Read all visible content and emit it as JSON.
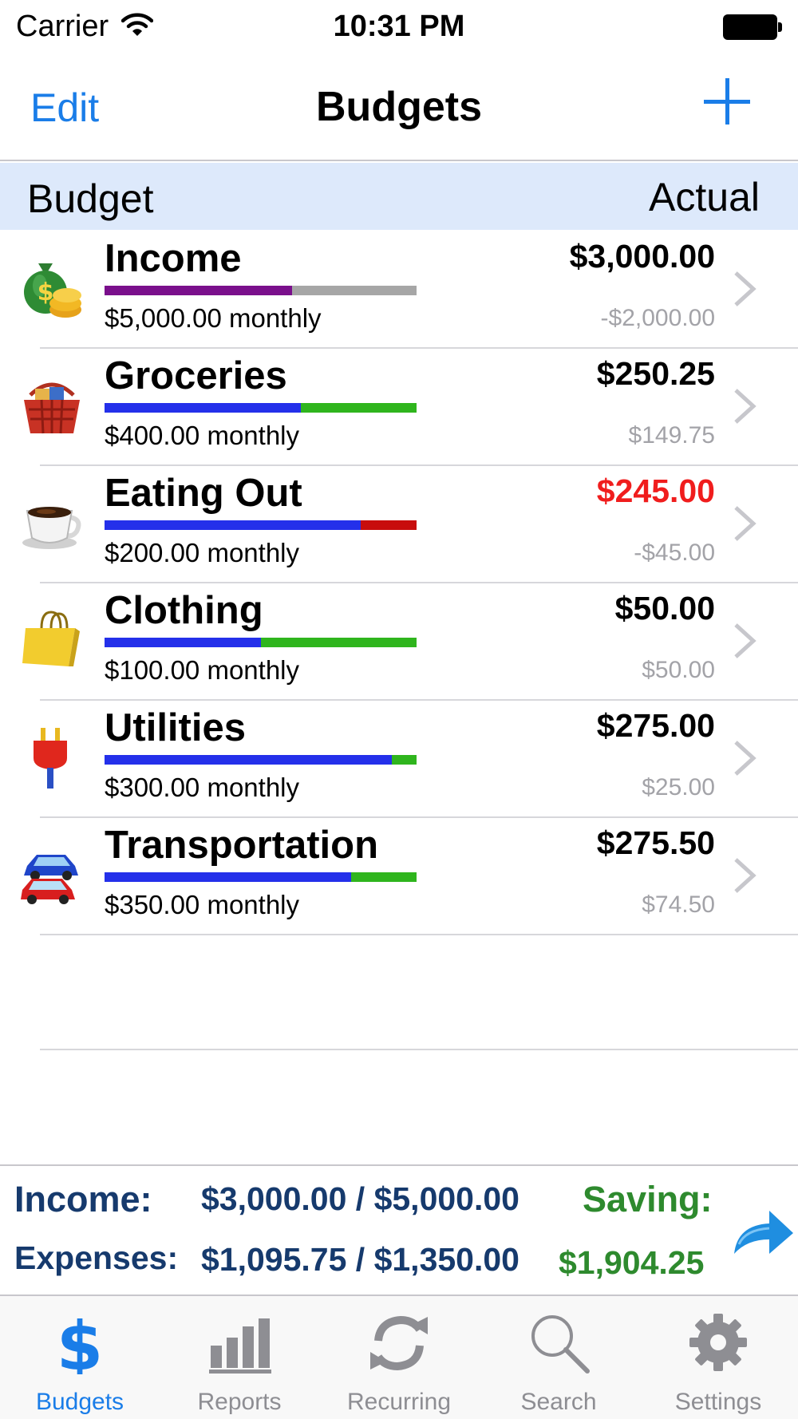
{
  "status_bar": {
    "carrier": "Carrier",
    "time": "10:31 PM"
  },
  "nav": {
    "edit_label": "Edit",
    "title": "Budgets"
  },
  "section_header": {
    "left": "Budget",
    "right": "Actual"
  },
  "rows": [
    {
      "name": "Income",
      "budget": "$5,000.00 monthly",
      "actual": "$3,000.00",
      "diff": "-$2,000.00",
      "icon": "money-bag-icon",
      "progress": 0.6,
      "fill_color": "#7a0f8c",
      "rest_color": "#a6a6a6",
      "actual_color": "#000000"
    },
    {
      "name": "Groceries",
      "budget": "$400.00 monthly",
      "actual": "$250.25",
      "diff": "$149.75",
      "icon": "grocery-basket-icon",
      "progress": 0.63,
      "fill_color": "#2430ea",
      "rest_color": "#2fb51d",
      "actual_color": "#000000"
    },
    {
      "name": "Eating Out",
      "budget": "$200.00 monthly",
      "actual": "$245.00",
      "diff": "-$45.00",
      "icon": "coffee-cup-icon",
      "progress": 0.82,
      "fill_color": "#2430ea",
      "rest_color": "#c80d0d",
      "actual_color": "#f01d1d"
    },
    {
      "name": "Clothing",
      "budget": "$100.00 monthly",
      "actual": "$50.00",
      "diff": "$50.00",
      "icon": "shopping-bag-icon",
      "progress": 0.5,
      "fill_color": "#2430ea",
      "rest_color": "#2fb51d",
      "actual_color": "#000000"
    },
    {
      "name": "Utilities",
      "budget": "$300.00 monthly",
      "actual": "$275.00",
      "diff": "$25.00",
      "icon": "power-plug-icon",
      "progress": 0.92,
      "fill_color": "#2430ea",
      "rest_color": "#2fb51d",
      "actual_color": "#000000"
    },
    {
      "name": "Transportation",
      "budget": "$350.00 monthly",
      "actual": "$275.50",
      "diff": "$74.50",
      "icon": "cars-icon",
      "progress": 0.79,
      "fill_color": "#2430ea",
      "rest_color": "#2fb51d",
      "actual_color": "#000000"
    }
  ],
  "summary": {
    "income_label": "Income:",
    "income_value": "$3,000.00 / $5,000.00",
    "expenses_label": "Expenses:",
    "expenses_value": "$1,095.75 / $1,350.00",
    "saving_label": "Saving:",
    "saving_value": "$1,904.25"
  },
  "tabs": [
    {
      "label": "Budgets",
      "icon": "dollar-icon",
      "active": true
    },
    {
      "label": "Reports",
      "icon": "bar-chart-icon",
      "active": false
    },
    {
      "label": "Recurring",
      "icon": "recurring-arrows-icon",
      "active": false
    },
    {
      "label": "Search",
      "icon": "magnifier-icon",
      "active": false
    },
    {
      "label": "Settings",
      "icon": "gear-icon",
      "active": false
    }
  ],
  "colors": {
    "accent": "#1a7de8",
    "header_bg": "#dde9fb",
    "summary_text": "#163a6d",
    "saving_text": "#2e8a2e"
  }
}
